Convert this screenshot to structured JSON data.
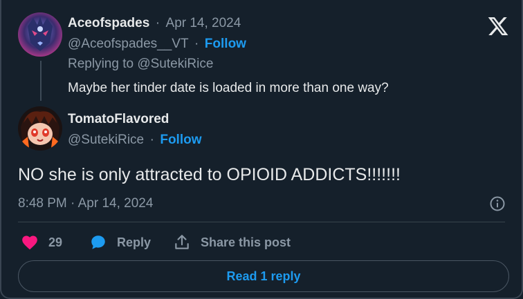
{
  "parent_tweet": {
    "display_name": "Aceofspades",
    "separator": "·",
    "date": "Apr 14, 2024",
    "handle": "@Aceofspades__VT",
    "follow_label": "Follow",
    "replying_to": "Replying to @SutekiRice",
    "text": "Maybe her tinder date is loaded in more than one way?"
  },
  "main_tweet": {
    "display_name": "TomatoFlavored",
    "handle": "@SutekiRice",
    "separator": "·",
    "follow_label": "Follow",
    "text": "NO she is only attracted to OPIOID ADDICTS!!!!!!!",
    "timestamp": "8:48 PM · Apr 14, 2024"
  },
  "actions": {
    "like_count": "29",
    "reply_label": "Reply",
    "share_label": "Share this post"
  },
  "read_replies_label": "Read 1 reply",
  "colors": {
    "background": "#15202b",
    "accent": "#1d9bf0",
    "like": "#f91880",
    "muted": "#8b98a5"
  },
  "icons": [
    "x-logo-icon",
    "info-icon",
    "heart-icon",
    "reply-bubble-icon",
    "share-icon"
  ]
}
